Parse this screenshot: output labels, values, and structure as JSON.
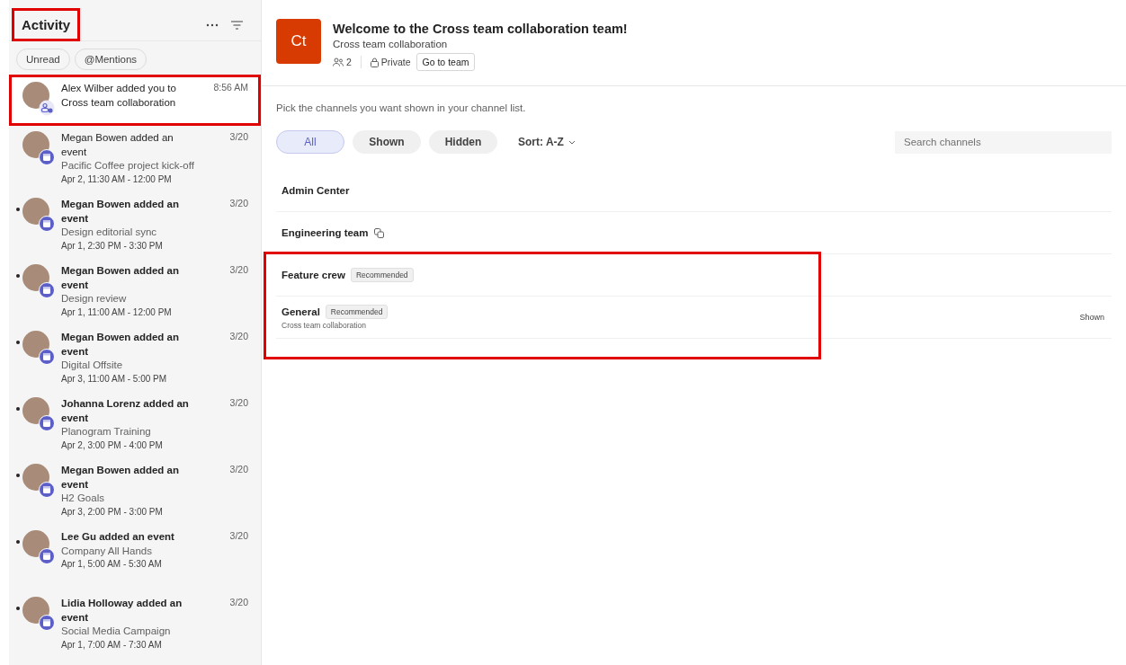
{
  "activity": {
    "title": "Activity",
    "title_highlighted": true,
    "filters": [
      {
        "label": "Unread",
        "selected": false
      },
      {
        "label": "@Mentions",
        "selected": false
      }
    ],
    "items": [
      {
        "kind": "team",
        "text": "Alex Wilber added you to Cross team collaboration",
        "time": "8:56 AM",
        "unread": false,
        "highlighted": true
      },
      {
        "kind": "event",
        "text": "Megan Bowen added an event",
        "detail": "Pacific Coffee project kick-off",
        "when": "Apr 2, 11:30 AM - 12:00 PM",
        "time": "3/20",
        "unread": false,
        "highlighted": false
      },
      {
        "kind": "event",
        "text": "Megan Bowen added an event",
        "detail": "Design editorial sync",
        "when": "Apr 1, 2:30 PM - 3:30 PM",
        "time": "3/20",
        "unread": true,
        "highlighted": false
      },
      {
        "kind": "event",
        "text": "Megan Bowen added an event",
        "detail": "Design review",
        "when": "Apr 1, 11:00 AM - 12:00 PM",
        "time": "3/20",
        "unread": true,
        "highlighted": false
      },
      {
        "kind": "event",
        "text": "Megan Bowen added an event",
        "detail": "Digital Offsite",
        "when": "Apr 3, 11:00 AM - 5:00 PM",
        "time": "3/20",
        "unread": true,
        "highlighted": false
      },
      {
        "kind": "event",
        "text": "Johanna Lorenz added an event",
        "detail": "Planogram Training",
        "when": "Apr 2, 3:00 PM - 4:00 PM",
        "time": "3/20",
        "unread": true,
        "highlighted": false
      },
      {
        "kind": "event",
        "text": "Megan Bowen added an event",
        "detail": "H2 Goals",
        "when": "Apr 3, 2:00 PM - 3:00 PM",
        "time": "3/20",
        "unread": true,
        "highlighted": false
      },
      {
        "kind": "event",
        "text": "Lee Gu added an event",
        "detail": "Company All Hands",
        "when": "Apr 1, 5:00 AM - 5:30 AM",
        "time": "3/20",
        "unread": true,
        "highlighted": false
      },
      {
        "kind": "event",
        "text": "Lidia Holloway added an event",
        "detail": "Social Media Campaign",
        "when": "Apr 1, 7:00 AM - 7:30 AM",
        "time": "3/20",
        "unread": true,
        "highlighted": false
      }
    ]
  },
  "team": {
    "initials": "Ct",
    "color": "#d83b01",
    "title": "Welcome to the Cross team collaboration team!",
    "name": "Cross team collaboration",
    "members": "2",
    "privacy": "Private",
    "go_button": "Go to team"
  },
  "channels": {
    "instructions": "Pick the channels you want shown in your channel list.",
    "filters": [
      {
        "label": "All",
        "selected": true
      },
      {
        "label": "Shown",
        "selected": false
      },
      {
        "label": "Hidden",
        "selected": false
      }
    ],
    "sort": "Sort: A-Z",
    "search": {
      "placeholder": "Search channels"
    },
    "items": [
      {
        "name": "Admin Center",
        "shared": false,
        "highlighted": false
      },
      {
        "name": "Engineering team",
        "shared": true,
        "highlighted": false
      },
      {
        "name": "Feature crew",
        "tag": "Recommended",
        "shared": false,
        "highlighted": true
      },
      {
        "name": "General",
        "tag": "Recommended",
        "description": "Cross team collaboration",
        "status": "Shown",
        "shared": false,
        "highlighted": true
      }
    ]
  }
}
